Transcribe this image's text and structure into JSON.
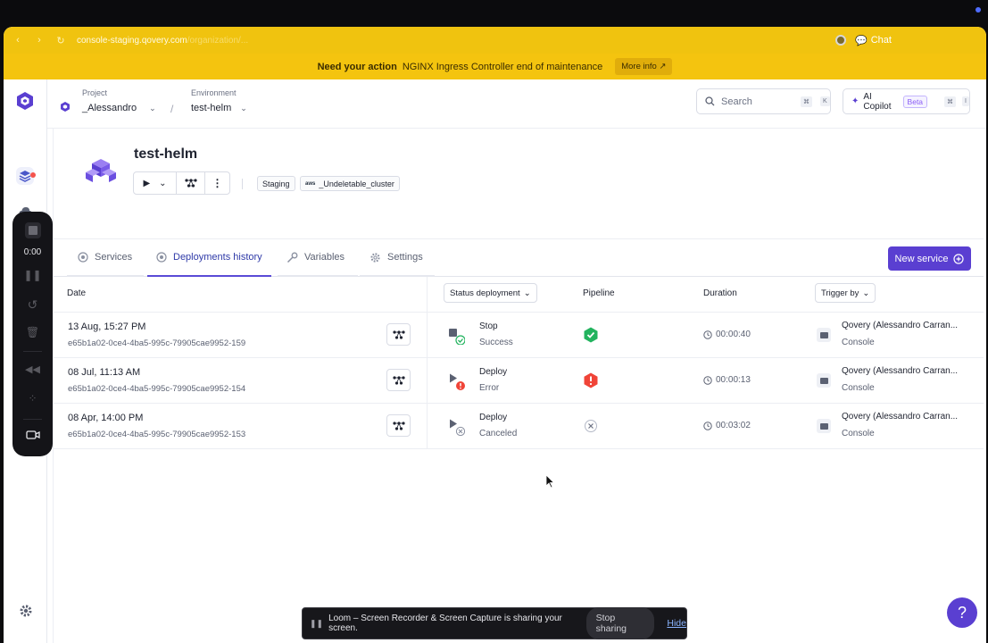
{
  "browser": {
    "url_host": "console-staging.qovery.com",
    "url_rest": "/organization/...",
    "chat_label": "Chat"
  },
  "banner": {
    "title": "Need your action",
    "message": "NGINX Ingress Controller end of maintenance",
    "more_label": "More info"
  },
  "header": {
    "project_label": "Project",
    "project_value": "_Alessandro",
    "environment_label": "Environment",
    "environment_value": "test-helm",
    "search_placeholder": "Search",
    "search_kbd": [
      "⌘",
      "K"
    ],
    "copilot_label": "AI Copilot",
    "copilot_badge": "Beta",
    "copilot_kbd": [
      "⌘",
      "I"
    ]
  },
  "loom": {
    "time": "0:00"
  },
  "environment": {
    "title": "test-helm",
    "type_tag": "Staging",
    "cluster_tag": "_Undeletable_cluster",
    "cloud_tag": "aws"
  },
  "tabs": [
    {
      "label": "Services"
    },
    {
      "label": "Deployments history"
    },
    {
      "label": "Variables"
    },
    {
      "label": "Settings"
    }
  ],
  "new_service_label": "New service",
  "table": {
    "headers": {
      "date": "Date",
      "status": "Status deployment",
      "pipeline": "Pipeline",
      "duration": "Duration",
      "trigger": "Trigger by"
    },
    "rows": [
      {
        "date": "13 Aug, 15:27 PM",
        "hash": "e65b1a02-0ce4-4ba5-995c-79905cae9952-159",
        "action": "Stop",
        "status": "Success",
        "pipeline": "success",
        "duration": "00:00:40",
        "trigger_name": "Qovery (Alessandro Carran...",
        "trigger_source": "Console"
      },
      {
        "date": "08 Jul, 11:13 AM",
        "hash": "e65b1a02-0ce4-4ba5-995c-79905cae9952-154",
        "action": "Deploy",
        "status": "Error",
        "pipeline": "error",
        "duration": "00:00:13",
        "trigger_name": "Qovery (Alessandro Carran...",
        "trigger_source": "Console"
      },
      {
        "date": "08 Apr, 14:00 PM",
        "hash": "e65b1a02-0ce4-4ba5-995c-79905cae9952-153",
        "action": "Deploy",
        "status": "Canceled",
        "pipeline": "canceled",
        "duration": "00:03:02",
        "trigger_name": "Qovery (Alessandro Carran...",
        "trigger_source": "Console"
      }
    ]
  },
  "sharebar": {
    "message": "Loom – Screen Recorder & Screen Capture is sharing your screen.",
    "stop_label": "Stop sharing",
    "hide_label": "Hide"
  },
  "help_label": "?",
  "colors": {
    "banner": "#f4c40f",
    "accent": "#5a3fd1",
    "success": "#22b35e",
    "error": "#f04438"
  }
}
